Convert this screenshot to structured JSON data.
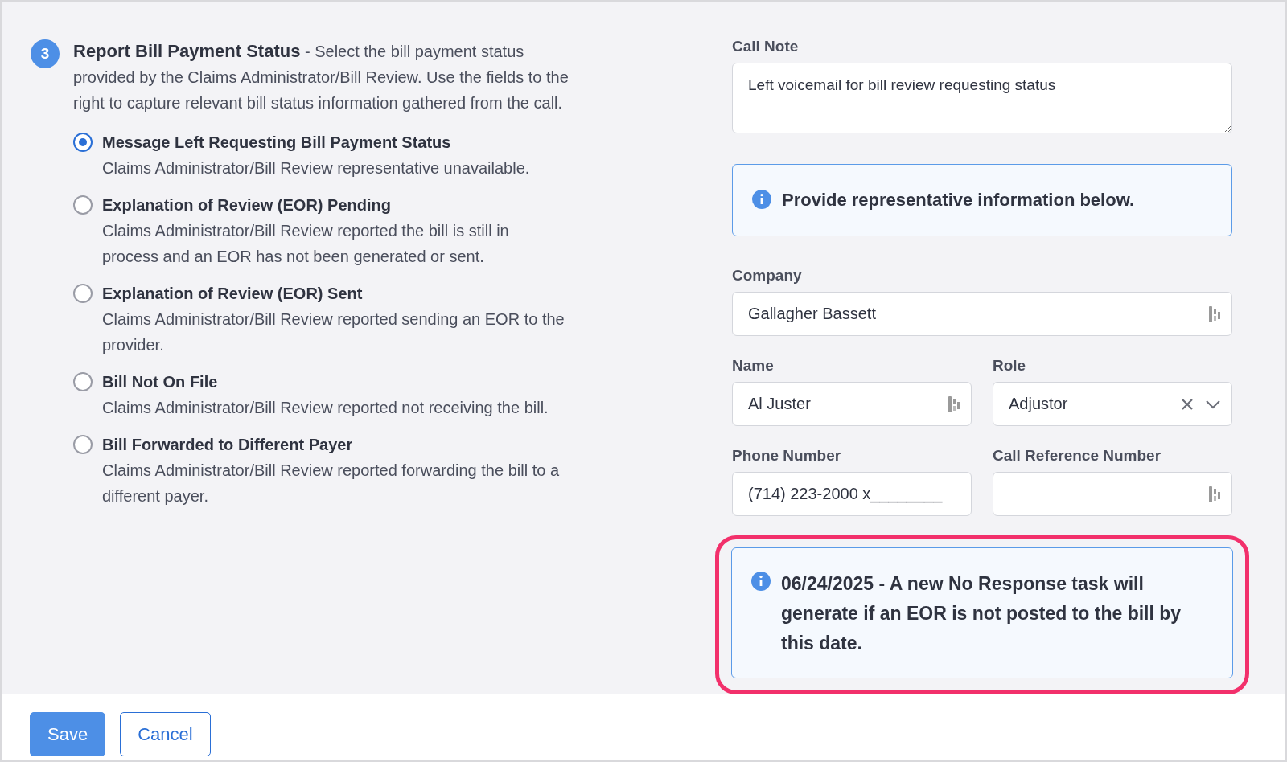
{
  "step": {
    "number": "3",
    "text": "**Report Bill Payment Status** - Select the bill payment status provided by the Claims Administrator/Bill Review. Use the fields to the right to capture relevant bill status information gathered from the call."
  },
  "options": [
    {
      "label": "Message Left Requesting Bill Payment Status",
      "description": "Claims Administrator/Bill Review representative unavailable.",
      "selected": true
    },
    {
      "label": "Explanation of Review (EOR) Pending",
      "description": "Claims Administrator/Bill Review reported the bill is still in process and an EOR has not been generated or sent.",
      "selected": false
    },
    {
      "label": "Explanation of Review (EOR) Sent",
      "description": "Claims Administrator/Bill Review reported sending an EOR to the provider.",
      "selected": false
    },
    {
      "label": "Bill Not On File",
      "description": "Claims Administrator/Bill Review reported not receiving the bill.",
      "selected": false
    },
    {
      "label": "Bill Forwarded to Different Payer",
      "description": "Claims Administrator/Bill Review reported forwarding the bill to a different payer.",
      "selected": false
    }
  ],
  "call_note": {
    "label": "Call Note",
    "value": "Left voicemail for bill review requesting status"
  },
  "info_banner": {
    "text": "Provide representative information below."
  },
  "fields": [
    {
      "kind": "text",
      "label": "Company",
      "value": "Gallagher Bassett",
      "wide": true
    },
    {
      "kind": "text",
      "label": "Name",
      "value": "Al Juster",
      "wide": false
    },
    {
      "kind": "select",
      "label": "Role",
      "value": "Adjustor",
      "wide": false
    },
    {
      "kind": "phone",
      "label": "Phone Number",
      "value": "(714) 223-2000 x________",
      "wide": false
    },
    {
      "kind": "text",
      "label": "Call Reference Number",
      "wide": false
    }
  ],
  "alert": {
    "text": "06/24/2025 - A new No Response task will generate if an EOR is not posted to the bill by this date.",
    "highlighted": true
  },
  "buttons": [
    {
      "label": "Save",
      "kind": "primary"
    },
    {
      "label": "Cancel",
      "kind": "secondary"
    }
  ]
}
